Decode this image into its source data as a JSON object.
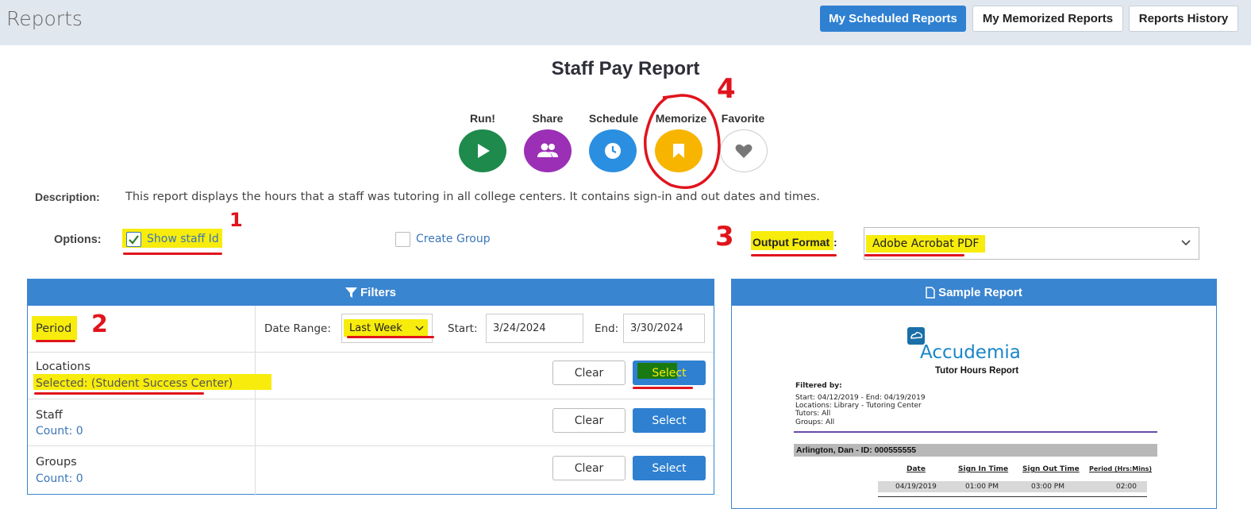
{
  "app_title": "Reports",
  "header_buttons": {
    "scheduled": "My Scheduled Reports",
    "memorized": "My Memorized Reports",
    "history": "Reports History"
  },
  "report_title": "Staff Pay Report",
  "actions": [
    {
      "label": "Run!",
      "color": "#1e8a4c",
      "icon": "play-icon"
    },
    {
      "label": "Share",
      "color": "#9b2fb5",
      "icon": "users-icon"
    },
    {
      "label": "Schedule",
      "color": "#2a8fe0",
      "icon": "clock-icon"
    },
    {
      "label": "Memorize",
      "color": "#f7b500",
      "icon": "bookmark-icon"
    },
    {
      "label": "Favorite",
      "color": "#ffffff",
      "icon": "heart-icon"
    }
  ],
  "description": {
    "label": "Description:",
    "text": "This report displays the hours that a staff was tutoring in all college centers. It contains sign-in and out dates and times."
  },
  "options": {
    "label": "Options:",
    "show_staff_id": {
      "label": "Show staff Id",
      "checked": true
    },
    "create_group": {
      "label": "Create Group",
      "checked": false
    },
    "output_format_label": "Output Format",
    "output_format_colon": ":",
    "output_format_value": "Adobe Acrobat PDF"
  },
  "annotations": {
    "one": "1",
    "two": "2",
    "three": "3",
    "four": "4"
  },
  "filters": {
    "title": "Filters",
    "period": {
      "label": "Period",
      "date_range_label": "Date Range:",
      "date_range_value": "Last Week",
      "start_label": "Start:",
      "start_value": "3/24/2024",
      "end_label": "End:",
      "end_value": "3/30/2024"
    },
    "rows": [
      {
        "title": "Locations",
        "sub": "Selected: (Student Success Center)",
        "clear": "Clear",
        "select": "Select"
      },
      {
        "title": "Staff",
        "sub": "Count: 0",
        "clear": "Clear",
        "select": "Select"
      },
      {
        "title": "Groups",
        "sub": "Count: 0",
        "clear": "Clear",
        "select": "Select"
      }
    ]
  },
  "sample": {
    "title": "Sample Report",
    "brand": "Accudemia",
    "subtitle": "Tutor Hours Report",
    "filtered_by": "Filtered by:",
    "filter_lines": [
      "Start: 04/12/2019 - End: 04/19/2019",
      "Locations: Library - Tutoring Center",
      "Tutors: All",
      "Groups: All"
    ],
    "person": "Arlington, Dan  - ID: 000555555",
    "columns": [
      "Date",
      "Sign In Time",
      "Sign Out Time",
      "Period (Hrs:Mins)"
    ],
    "row": [
      "04/19/2019",
      "01:00 PM",
      "03:00 PM",
      "02:00"
    ]
  }
}
